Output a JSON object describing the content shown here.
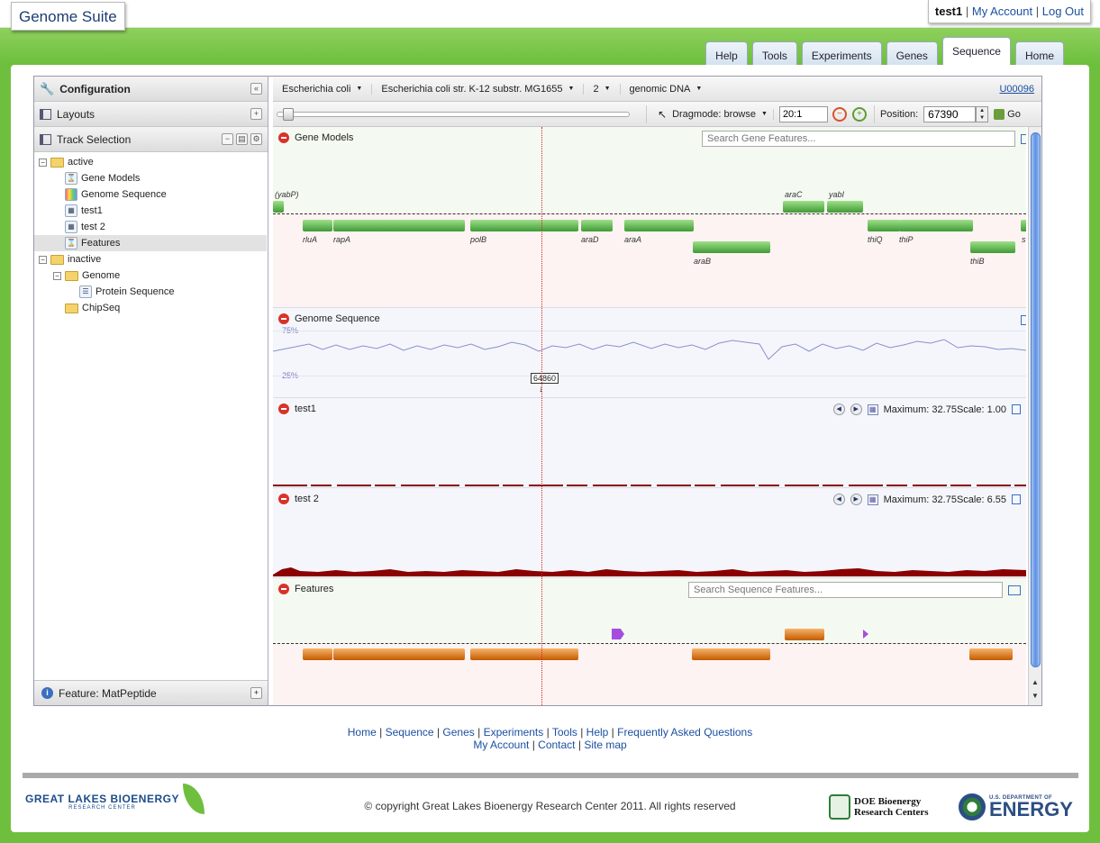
{
  "app": {
    "title": "Genome Suite"
  },
  "account": {
    "user": "test1",
    "my_account": "My Account",
    "logout": "Log Out",
    "sep": "|"
  },
  "tabs": [
    {
      "label": "Help"
    },
    {
      "label": "Tools"
    },
    {
      "label": "Experiments"
    },
    {
      "label": "Genes"
    },
    {
      "label": "Sequence",
      "active": true
    },
    {
      "label": "Home"
    }
  ],
  "left": {
    "configuration": "Configuration",
    "layouts": "Layouts",
    "track_selection": "Track Selection",
    "tree": [
      {
        "label": "active",
        "type": "folder",
        "expanded": true
      },
      {
        "label": "Gene Models",
        "type": "track"
      },
      {
        "label": "Genome Sequence",
        "type": "track"
      },
      {
        "label": "test1",
        "type": "track"
      },
      {
        "label": "test 2",
        "type": "track"
      },
      {
        "label": "Features",
        "type": "track",
        "selected": true
      },
      {
        "label": "inactive",
        "type": "folder",
        "expanded": true
      },
      {
        "label": "Genome",
        "type": "folder",
        "expanded": true
      },
      {
        "label": "Protein Sequence",
        "type": "track"
      },
      {
        "label": "ChipSeq",
        "type": "folder"
      }
    ],
    "feature_panel": "Feature: MatPeptide"
  },
  "toolbar": {
    "organism": "Escherichia coli",
    "strain": "Escherichia coli str. K-12 substr. MG1655",
    "chromosome": "2",
    "type": "genomic DNA",
    "accession": "U00096",
    "dragmode": "Dragmode: browse",
    "zoom": "20:1",
    "position_label": "Position:",
    "position": "67390",
    "go": "Go"
  },
  "tracks": {
    "gene_models": {
      "title": "Gene Models",
      "search_placeholder": "Search Gene Features...",
      "genes": [
        "(yabP)",
        "araC",
        "yabI",
        "rluA",
        "rapA",
        "polB",
        "araD",
        "araA",
        "araB",
        "thiQ",
        "thiP",
        "thiB",
        "s"
      ]
    },
    "genome_sequence": {
      "title": "Genome Sequence",
      "pct_high": "75%",
      "pct_low": "25%",
      "cursor": "64860"
    },
    "test1": {
      "title": "test1",
      "maximum": "Maximum: 32.75",
      "scale": "Scale: 1.00"
    },
    "test2": {
      "title": "test 2",
      "maximum": "Maximum: 32.75",
      "scale": "Scale: 6.55"
    },
    "features": {
      "title": "Features",
      "search_placeholder": "Search Sequence Features..."
    }
  },
  "footer": {
    "links1": [
      "Home",
      "Sequence",
      "Genes",
      "Experiments",
      "Tools",
      "Help",
      "Frequently Asked Questions"
    ],
    "links2": [
      "My Account",
      "Contact",
      "Site map"
    ],
    "copyright": "© copyright Great Lakes Bioenergy Research Center 2011. All rights reserved",
    "glbrc_1": "GREAT LAKES BIOENERGY",
    "glbrc_2": "RESEARCH CENTER",
    "doe_brc_1": "DOE Bioenergy",
    "doe_brc_2": "Research Centers",
    "doe_1": "U.S. DEPARTMENT OF",
    "doe_2": "ENERGY"
  },
  "colors": {
    "brand_green": "#6fbf3f",
    "link": "#1b50a0",
    "gene": "#4aa83c",
    "feature": "#d9741a",
    "signal": "#8b0000",
    "cursor": "#dd2222"
  }
}
